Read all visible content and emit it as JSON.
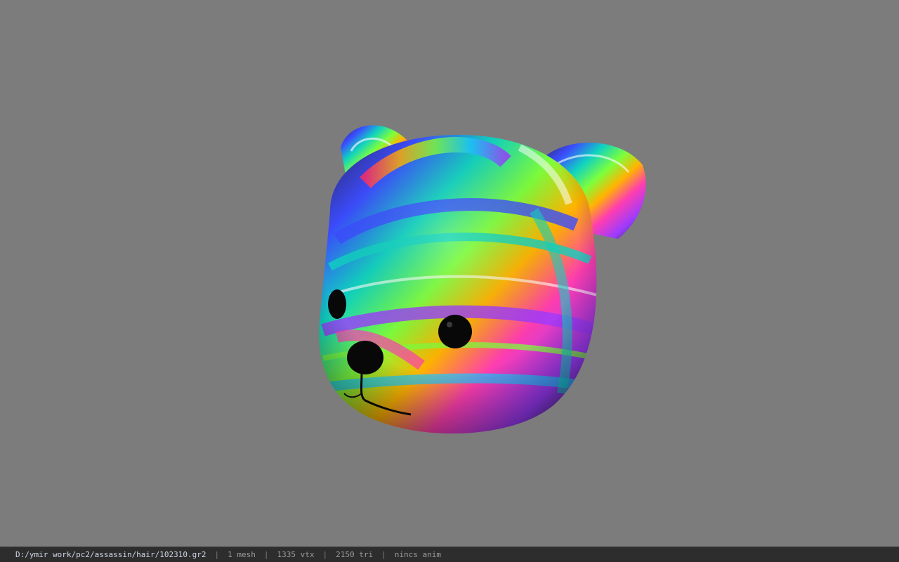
{
  "viewport": {
    "background_color": "#7c7c7c",
    "model": {
      "subject": "holographic bear head",
      "colors": [
        "#2a1f3d",
        "#0fd3c0",
        "#3b4cff",
        "#ff3db0",
        "#ffb400",
        "#7dff3c",
        "#9c3bff"
      ]
    }
  },
  "statusbar": {
    "path": "D:/ymir work/pc2/assassin/hair/102310.gr2",
    "separator": "|",
    "mesh": "1 mesh",
    "vtx": "1335 vtx",
    "tri": "2150 tri",
    "anim": "nincs anim"
  }
}
